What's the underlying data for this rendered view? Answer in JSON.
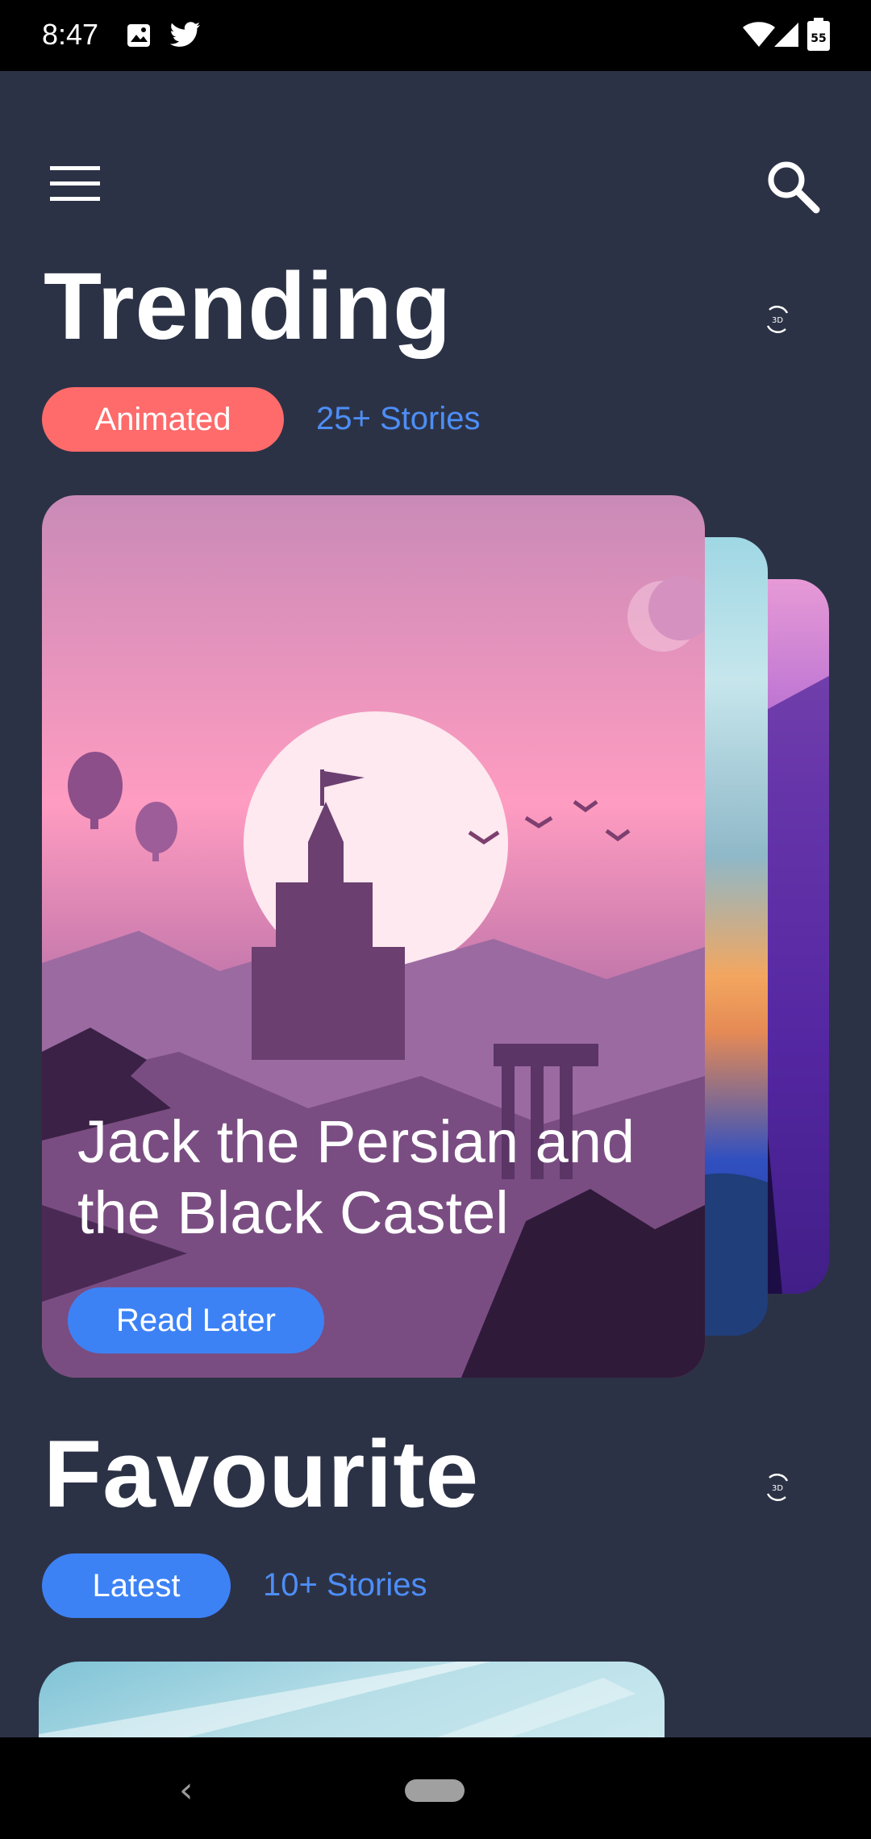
{
  "status_bar": {
    "time": "8:47",
    "icons": [
      "image-icon",
      "twitter-icon",
      "wifi-icon",
      "signal-icon",
      "battery-icon"
    ],
    "battery": "55"
  },
  "header": {
    "menu_icon": "hamburger-menu-icon",
    "search_icon": "search-icon"
  },
  "trending": {
    "title": "Trending",
    "icon": "3d-rotate-icon",
    "pill_label": "Animated",
    "count_label": "25+ Stories",
    "card": {
      "title": "Jack the Persian and the Black Castel",
      "button_label": "Read Later"
    }
  },
  "favourite": {
    "title": "Favourite",
    "icon": "3d-rotate-icon",
    "pill_label": "Latest",
    "count_label": "10+ Stories"
  },
  "colors": {
    "background": "#2c3246",
    "pill_red": "#ff6b6b",
    "accent_blue": "#3d82f5",
    "link_blue": "#4d8ef7"
  },
  "nav_bar": {
    "back_glyph": "‹"
  }
}
